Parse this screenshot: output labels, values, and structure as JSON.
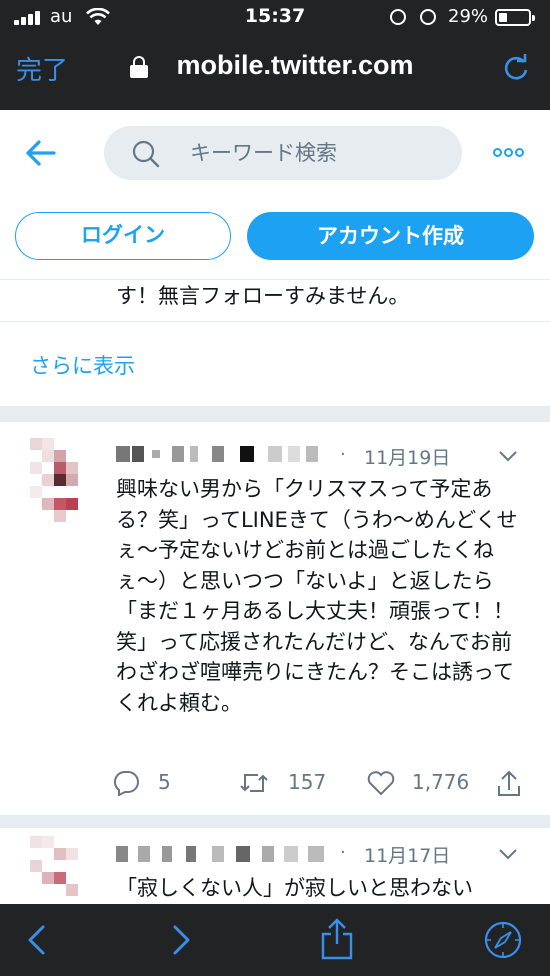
{
  "status_bar": {
    "carrier": "au",
    "time": "15:37",
    "battery_percent": "29%",
    "battery_level": 0.29,
    "icons": [
      "signal-icon",
      "wifi-icon",
      "rotation-lock-icon",
      "alarm-icon",
      "battery-icon"
    ]
  },
  "browser": {
    "done_label": "完了",
    "url": "mobile.twitter.com",
    "icons": [
      "lock-icon",
      "reload-icon"
    ]
  },
  "header": {
    "search_placeholder": "キーワード検索",
    "login_label": "ログイン",
    "signup_label": "アカウント作成",
    "icons": [
      "back-arrow-icon",
      "search-icon",
      "more-icon"
    ]
  },
  "timeline": {
    "previous_tweet_tail": "す！無言フォローすみません。",
    "show_more_label": "さらに表示",
    "tweets": [
      {
        "separator": "·",
        "date": "11月19日",
        "text": "興味ない男から「クリスマスって予定ある？笑」ってLINEきて（うわ〜めんどくせぇ〜予定ないけどお前とは過ごしたくねぇ〜）と思いつつ「ないよ」と返したら「まだ１ヶ月あるし大丈夫！頑張って！！笑」って応援されたんだけど、なんでお前わざわざ喧嘩売りにきたん？そこは誘ってくれよ頼む。",
        "reply_count": "5",
        "retweet_count": "157",
        "like_count": "1,776"
      },
      {
        "separator": "·",
        "date": "11月17日",
        "text": "「寂しくない人」が寂しいと思わない"
      }
    ]
  },
  "toolbar": {
    "icons": [
      "back-icon",
      "forward-icon",
      "share-icon",
      "compass-icon"
    ]
  },
  "colors": {
    "twitter_blue": "#1da1f2",
    "ios_link_blue": "#3b8fe8",
    "chrome_dark": "#222325",
    "muted_text": "#657786",
    "divider": "#e6ecf0"
  }
}
